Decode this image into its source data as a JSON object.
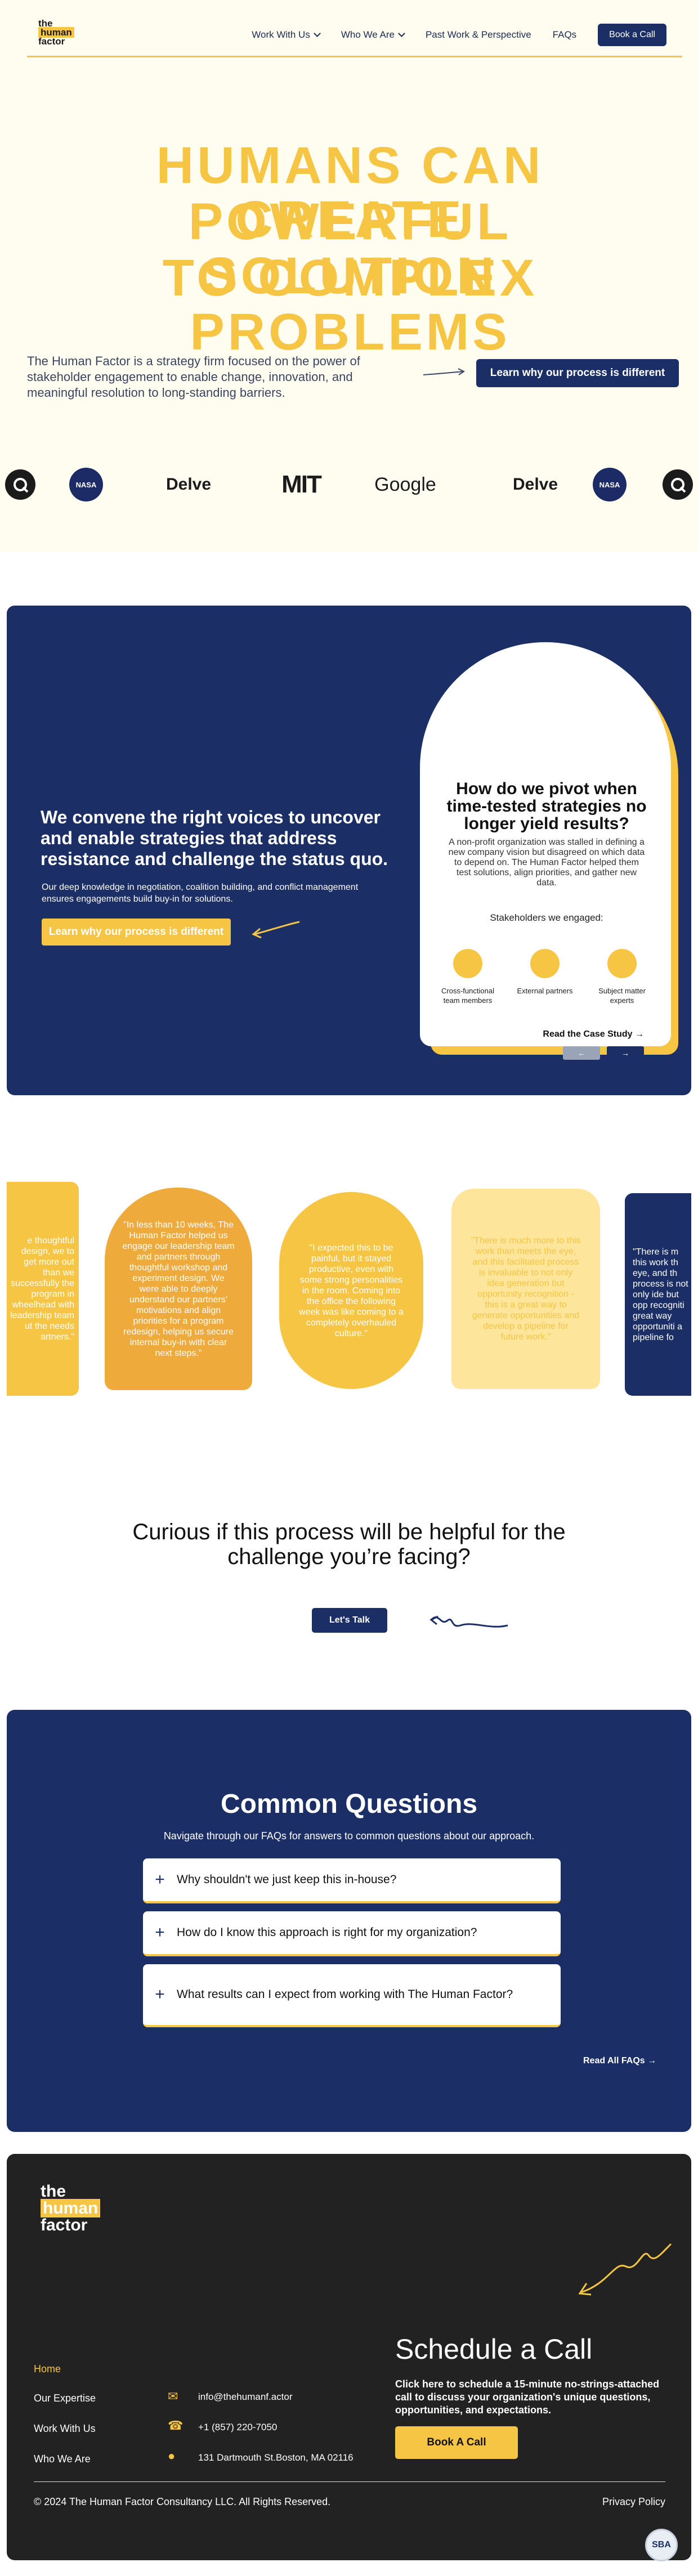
{
  "header": {
    "logo": [
      "the",
      "human",
      "factor"
    ],
    "nav": [
      "Work With Us",
      "Who We Are",
      "Past Work & Perspective",
      "FAQs"
    ],
    "cta": "Book a Call"
  },
  "hero": {
    "lines": [
      "HUMANS CAN CREATE",
      "POWERFUL SOLUTION",
      "TO COMPLEX PROBLEMS"
    ],
    "description": "The Human Factor is a strategy firm focused on the power of stakeholder engagement to enable change, innovation, and meaningful resolution to long-standing barriers.",
    "cta": "Learn why our process is different"
  },
  "logos": {
    "nasa": "NASA",
    "delve": "Delve",
    "mit": "MIT",
    "google": "Google"
  },
  "convene": {
    "heading": "We convene the right voices to uncover and enable strategies that address resistance and challenge the status quo.",
    "body": "Our deep knowledge in negotiation, coalition building, and conflict management ensures engagements build buy-in for solutions.",
    "cta": "Learn why our process is different"
  },
  "case_study": {
    "heading": "How do we pivot when time-tested strategies no longer yield results?",
    "body": "A non-profit organization was stalled in defining a new company vision but disagreed on which data to depend on. The Human Factor helped them test solutions, align priorities, and gather new data.",
    "subheading": "Stakeholders we engaged:",
    "stakeholders": [
      "Cross-functional team members",
      "External partners",
      "Subject matter experts"
    ],
    "link": "Read the Case Study →",
    "prev": "←",
    "next": "→"
  },
  "testimonials": [
    "e thoughtful design, we to get more out than we successfully the program in wheelhead with leadership team ut the needs artners.\"",
    "\"In less than 10 weeks, The Human Factor helped us engage our leadership team and partners through thoughtful workshop and experiment design. We were able to deeply understand our partners' motivations and align priorities for a program redesign, helping us secure internal buy-in with clear next steps.\"",
    "\"I expected this to be painful, but it stayed productive, even with some strong personalities in the room. Coming into the office the following week was like coming to a completely overhauled culture.\"",
    "\"There is much more to this work than meets the eye, and this facilitated process is invaluable to not only idea generation but opportunity recognition - this is a great way to generate opportunities and develop a pipeline for future work.\"",
    "\"There is m this work th eye, and th process is not only ide but opp recogniti great way opportuniti a pipeline fo"
  ],
  "curious": {
    "heading": "Curious if this process will be helpful for the challenge you’re facing?",
    "cta": "Let's Talk"
  },
  "faq": {
    "heading": "Common Questions",
    "subheading": "Navigate through our FAQs for answers to common questions about our approach.",
    "items": [
      "Why shouldn't we just keep this in-house?",
      "How do I know this approach is right for my organization?",
      "What results can I expect from working with The Human Factor?"
    ],
    "read_all": "Read All FAQs"
  },
  "footer": {
    "logo": [
      "the",
      "human",
      "factor"
    ],
    "nav": [
      "Home",
      "Our Expertise",
      "Work With Us",
      "Who We Are"
    ],
    "email": "info@thehumanf.actor",
    "phone": "+1 (857) 220-7050",
    "address": "131 Dartmouth St.Boston, MA 02116",
    "cta_heading": "Schedule a Call",
    "cta_body": "Click here to schedule a 15-minute no-strings-attached call to discuss your organization's unique questions, opportunities, and expectations.",
    "cta_button": "Book A Call",
    "copyright": "© 2024 The Human Factor Consultancy LLC. All Rights Reserved.",
    "privacy": "Privacy Policy"
  },
  "badge": "SBA",
  "colors": {
    "accent": "#f6c543",
    "navy": "#1b2f66",
    "cream": "#fffdf0",
    "footer": "#222222"
  }
}
